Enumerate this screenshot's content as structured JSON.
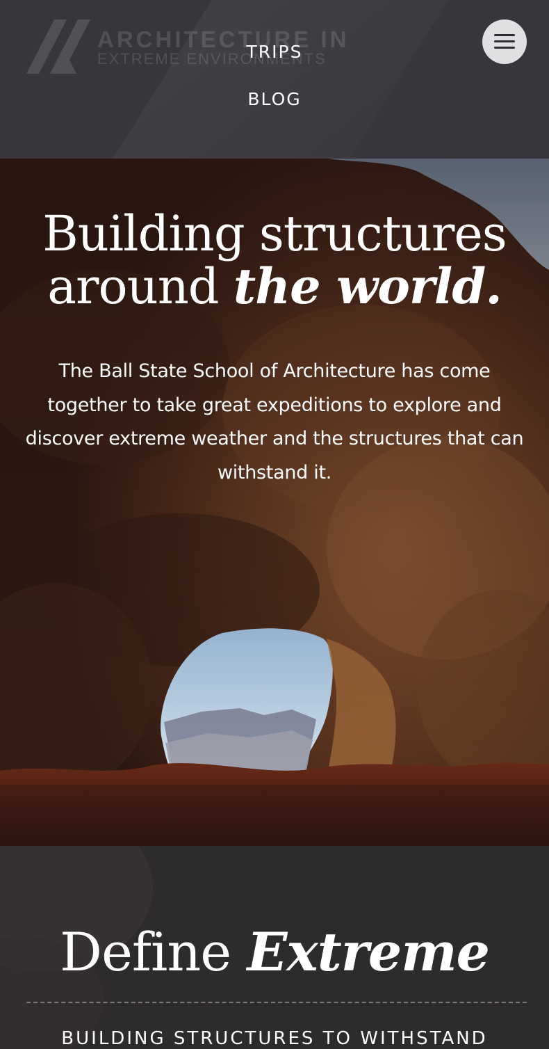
{
  "header": {
    "logo": {
      "line1": "ARCHITECTURE IN",
      "line2": "EXTREME ENVIRONMENTS"
    },
    "nav": {
      "trips": "TRIPS",
      "blog": "BLOG"
    },
    "menu_icon": "hamburger-icon"
  },
  "hero": {
    "title_line1": "Building structures",
    "title_line2_plain": "around ",
    "title_line2_emphasis": "the world.",
    "body": "The Ball State School of Architecture has come together to take great expeditions to explore and discover extreme weather and the structures that can withstand it."
  },
  "define": {
    "title_plain": "Define ",
    "title_emphasis": "Extreme",
    "subtitle": "BUILDING STRUCTURES TO WITHSTAND"
  },
  "colors": {
    "header_bg": "#38363b",
    "section_bg": "#2e2b2d",
    "menu_button_bg": "#e0dfe1",
    "text": "#ffffff"
  }
}
